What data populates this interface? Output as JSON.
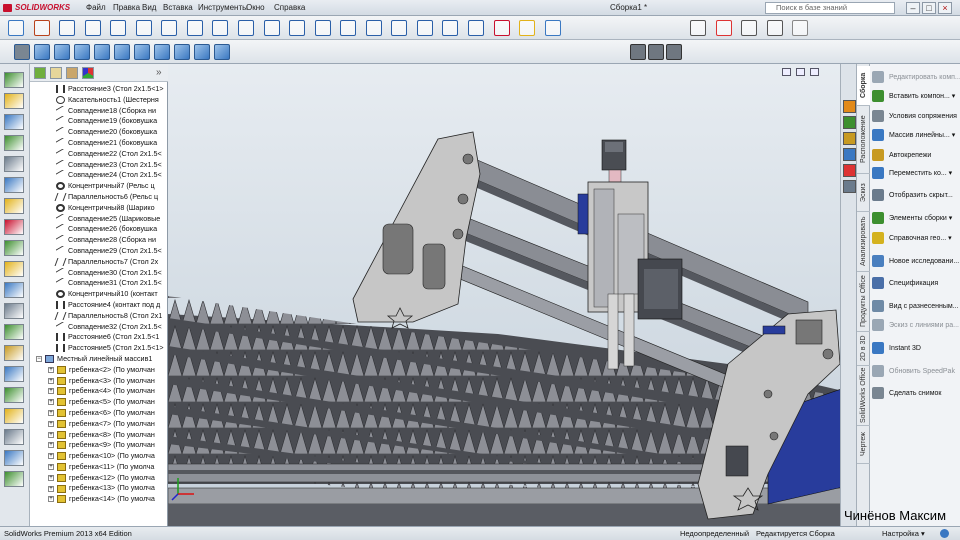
{
  "app": {
    "logo": "SOLIDWORKS",
    "document_title": "Сборка1 *"
  },
  "menu": [
    "Файл",
    "Правка",
    "Вид",
    "Вставка",
    "Инструменты",
    "Окно",
    "Справка"
  ],
  "search": {
    "placeholder": "Поиск в базе знаний"
  },
  "window_buttons": [
    "–",
    "□",
    "×"
  ],
  "tree": {
    "rows": [
      {
        "label": "Расстояние3 (Стол 2x1.5<1>",
        "icon": "distance-mate",
        "indent": 1
      },
      {
        "label": "Касательность1 (Шестерня",
        "icon": "tangent-mate",
        "indent": 1
      },
      {
        "label": "Совпадение18 (Сборка ни",
        "icon": "coincident-mate",
        "indent": 1
      },
      {
        "label": "Совпадение19 (боковушка",
        "icon": "coincident-mate",
        "indent": 1
      },
      {
        "label": "Совпадение20 (боковушка",
        "icon": "coincident-mate",
        "indent": 1
      },
      {
        "label": "Совпадение21 (боковушка",
        "icon": "coincident-mate",
        "indent": 1
      },
      {
        "label": "Совпадение22 (Стол 2x1.5<",
        "icon": "coincident-mate",
        "indent": 1
      },
      {
        "label": "Совпадение23 (Стол 2x1.5<",
        "icon": "coincident-mate",
        "indent": 1
      },
      {
        "label": "Совпадение24 (Стол 2x1.5<",
        "icon": "coincident-mate",
        "indent": 1
      },
      {
        "label": "Концентричный7 (Рельс ц",
        "icon": "concentric-mate",
        "indent": 1
      },
      {
        "label": "Параллельность6 (Рельс ц",
        "icon": "parallel-mate",
        "indent": 1
      },
      {
        "label": "Концентричный8 (Шарико",
        "icon": "concentric-mate",
        "indent": 1
      },
      {
        "label": "Совпадение25 (Шариковые",
        "icon": "coincident-mate",
        "indent": 1
      },
      {
        "label": "Совпадение26 (боковушка",
        "icon": "coincident-mate",
        "indent": 1
      },
      {
        "label": "Совпадение28 (Сборка ни",
        "icon": "coincident-mate",
        "indent": 1
      },
      {
        "label": "Совпадение29 (Стол 2x1.5<",
        "icon": "coincident-mate",
        "indent": 1
      },
      {
        "label": "Параллельность7 (Стол 2x",
        "icon": "parallel-mate",
        "indent": 1
      },
      {
        "label": "Совпадение30 (Стол 2x1.5<",
        "icon": "coincident-mate",
        "indent": 1
      },
      {
        "label": "Совпадение31 (Стол 2x1.5<",
        "icon": "coincident-mate",
        "indent": 1
      },
      {
        "label": "Концентричный10 (контакт",
        "icon": "concentric-mate",
        "indent": 1
      },
      {
        "label": "Расстояние4 (контакт под д",
        "icon": "distance-mate",
        "indent": 1
      },
      {
        "label": "Параллельность8 (Стол 2x1",
        "icon": "parallel-mate",
        "indent": 1
      },
      {
        "label": "Совпадение32 (Стол 2x1.5<",
        "icon": "coincident-mate",
        "indent": 1
      },
      {
        "label": "Расстояние6 (Стол 2x1.5<1",
        "icon": "distance-mate",
        "indent": 1
      },
      {
        "label": "Расстояние5 (Стол 2x1.5<1>",
        "icon": "distance-mate",
        "indent": 1
      },
      {
        "label": "Местный линейный массив1",
        "icon": "pattern",
        "indent": 0
      },
      {
        "label": "гребенка<2> (По умолчан",
        "icon": "part",
        "indent": 2
      },
      {
        "label": "гребенка<3> (По умолчан",
        "icon": "part",
        "indent": 2
      },
      {
        "label": "гребенка<4> (По умолчан",
        "icon": "part",
        "indent": 2
      },
      {
        "label": "гребенка<5> (По умолчан",
        "icon": "part",
        "indent": 2
      },
      {
        "label": "гребенка<6> (По умолчан",
        "icon": "part",
        "indent": 2
      },
      {
        "label": "гребенка<7> (По умолчан",
        "icon": "part",
        "indent": 2
      },
      {
        "label": "гребенка<8> (По умолчан",
        "icon": "part",
        "indent": 2
      },
      {
        "label": "гребенка<9> (По умолчан",
        "icon": "part",
        "indent": 2
      },
      {
        "label": "гребенка<10> (По умолча",
        "icon": "part",
        "indent": 2
      },
      {
        "label": "гребенка<11> (По умолча",
        "icon": "part",
        "indent": 2
      },
      {
        "label": "гребенка<12> (По умолча",
        "icon": "part",
        "indent": 2
      },
      {
        "label": "гребенка<13> (По умолча",
        "icon": "part",
        "indent": 2
      },
      {
        "label": "гребенка<14> (По умолча",
        "icon": "part",
        "indent": 2
      }
    ]
  },
  "right_tabs": [
    "Сборка",
    "Расположение",
    "Эскиз",
    "Анализировать",
    "Продукты Office",
    "2D в 3D",
    "SolidWorks Office",
    "Чертеж"
  ],
  "taskpane": [
    {
      "label": "Редактировать комп...",
      "dim": true,
      "icon_color": "#9aa7b4"
    },
    {
      "label": "Вставить компон... ▾",
      "dim": false,
      "icon_color": "#3d8f2f"
    },
    {
      "label": "Условия сопряжения",
      "dim": false,
      "icon_color": "#7a8692"
    },
    {
      "label": "Массив линейны... ▾",
      "dim": false,
      "icon_color": "#3a78c2"
    },
    {
      "label": "Автокрепежи",
      "dim": false,
      "icon_color": "#c79a22"
    },
    {
      "label": "Переместить ко... ▾",
      "dim": false,
      "icon_color": "#3a78c2"
    },
    {
      "label": "Отобразить скрыт...",
      "dim": false,
      "icon_color": "#6b7b8c"
    },
    {
      "label": "Элементы сборки ▾",
      "dim": false,
      "icon_color": "#3d8f2f"
    },
    {
      "label": "Справочная гео... ▾",
      "dim": false,
      "icon_color": "#d4b21f"
    },
    {
      "label": "Новое исследовани...",
      "dim": false,
      "icon_color": "#4a7fbf"
    },
    {
      "label": "Спецификация",
      "dim": false,
      "icon_color": "#4a6fa8"
    },
    {
      "label": "Вид с разнесенным...",
      "dim": false,
      "icon_color": "#6f8aa6"
    },
    {
      "label": "Эскиз с линиями ра...",
      "dim": true,
      "icon_color": "#9aa7b4"
    },
    {
      "label": "Instant 3D",
      "dim": false,
      "icon_color": "#3a78c2"
    },
    {
      "label": "Обновить SpeedPak",
      "dim": true,
      "icon_color": "#9aa7b4"
    },
    {
      "label": "Сделать снимок",
      "dim": false,
      "icon_color": "#7a8692"
    }
  ],
  "status": {
    "edition": "SolidWorks Premium 2013 x64 Edition",
    "definition": "Недоопределенный",
    "mode": "Редактируется Сборка",
    "custom": "Настройка ▾"
  },
  "watermark": "Чинёнов Максим",
  "colors": {
    "accent_red": "#c8102e",
    "frame": "#c4c4c4",
    "rails": "#7c8089",
    "blue_parts": "#283c9c"
  }
}
